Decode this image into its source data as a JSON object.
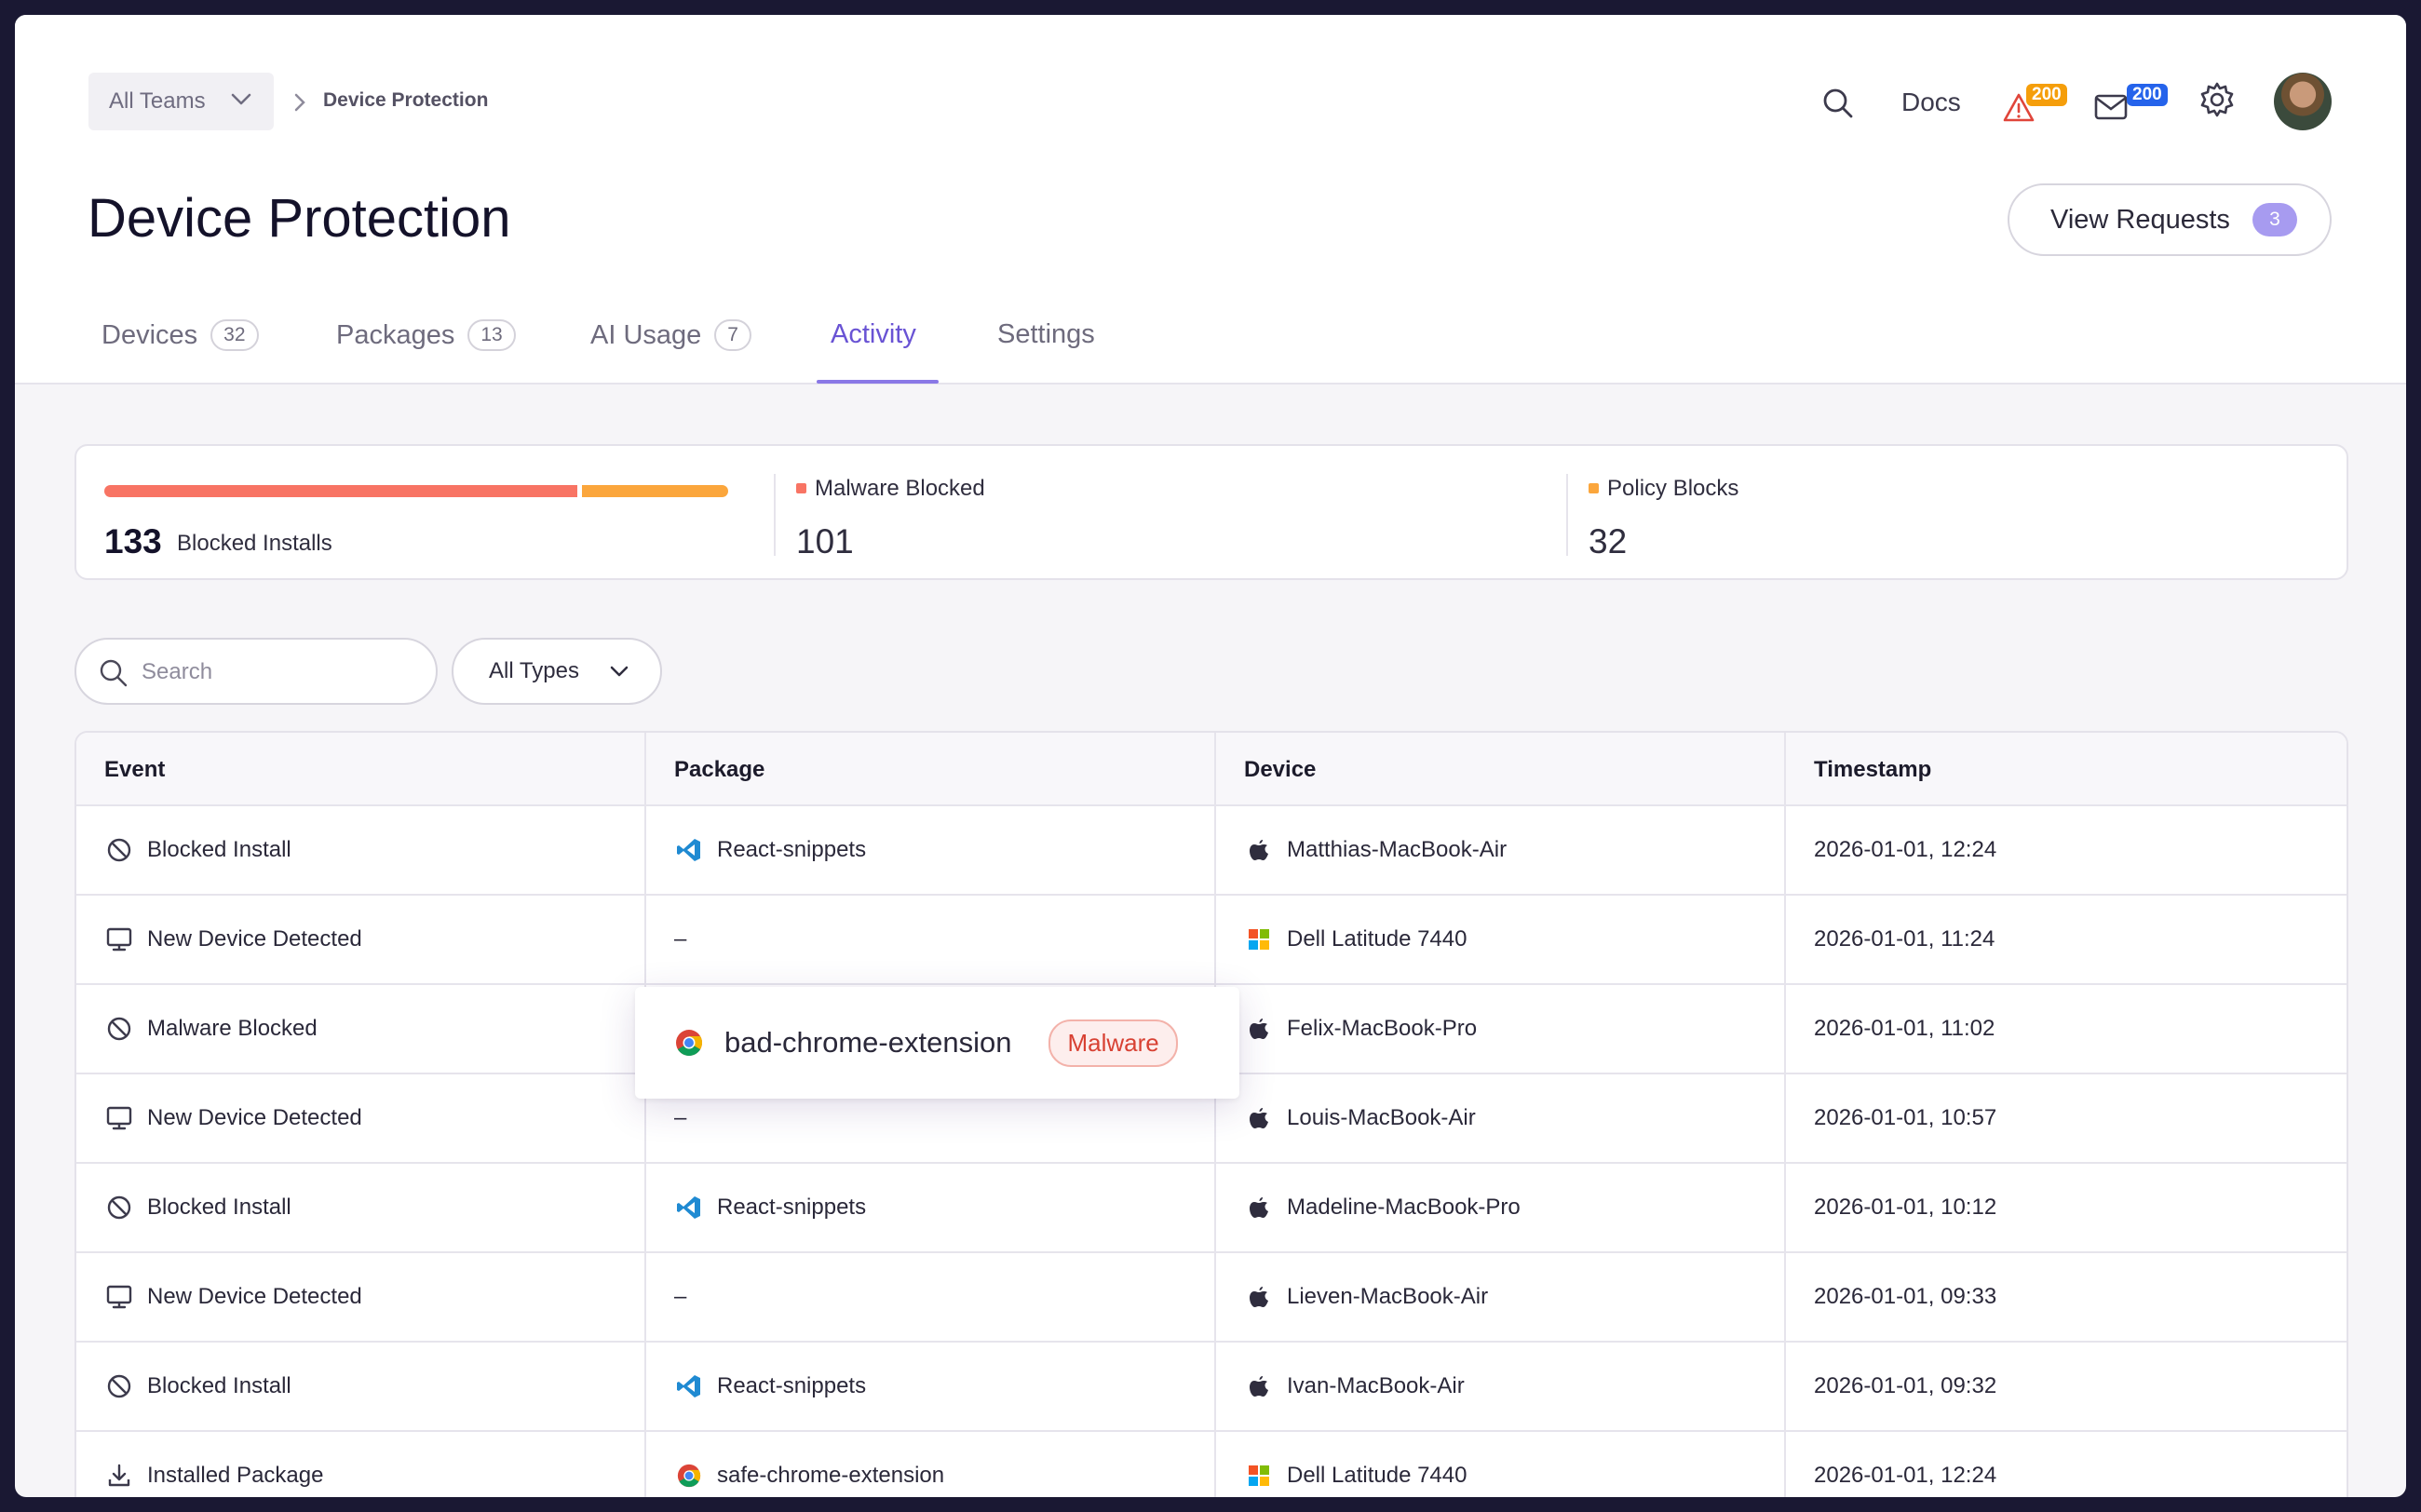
{
  "breadcrumb": {
    "team_select": "All Teams",
    "current": "Device Protection"
  },
  "header": {
    "docs": "Docs",
    "alerts_count": "200",
    "messages_count": "200",
    "alert_color": "#f59e0b",
    "message_color": "#2563eb"
  },
  "page": {
    "title": "Device Protection",
    "view_requests_label": "View Requests",
    "view_requests_count": "3"
  },
  "tabs": [
    {
      "label": "Devices",
      "count": "32"
    },
    {
      "label": "Packages",
      "count": "13"
    },
    {
      "label": "AI Usage",
      "count": "7"
    },
    {
      "label": "Activity",
      "active": true
    },
    {
      "label": "Settings"
    }
  ],
  "summary": {
    "total": "133",
    "total_label": "Blocked Installs",
    "malware_label": "Malware Blocked",
    "malware_value": "101",
    "policy_label": "Policy Blocks",
    "policy_value": "32",
    "malware_color": "#f87464",
    "policy_color": "#fba63c"
  },
  "filters": {
    "search_placeholder": "Search",
    "type_select": "All Types"
  },
  "table": {
    "headers": {
      "event": "Event",
      "package": "Package",
      "device": "Device",
      "timestamp": "Timestamp"
    },
    "rows": [
      {
        "event_icon": "blocked-icon",
        "event": "Blocked Install",
        "package_icon": "vscode-icon",
        "package": "React-snippets",
        "device_icon": "apple-icon",
        "device": "Matthias-MacBook-Air",
        "timestamp": "2026-01-01, 12:24"
      },
      {
        "event_icon": "monitor-icon",
        "event": "New Device Detected",
        "package_icon": "",
        "package": "–",
        "device_icon": "windows-icon",
        "device": "Dell Latitude 7440",
        "timestamp": "2026-01-01, 11:24"
      },
      {
        "event_icon": "blocked-icon",
        "event": "Malware Blocked",
        "package_icon": "",
        "package": "",
        "device_icon": "apple-icon",
        "device": "Felix-MacBook-Pro",
        "timestamp": "2026-01-01, 11:02"
      },
      {
        "event_icon": "monitor-icon",
        "event": "New Device Detected",
        "package_icon": "",
        "package": "–",
        "device_icon": "apple-icon",
        "device": "Louis-MacBook-Air",
        "timestamp": "2026-01-01, 10:57"
      },
      {
        "event_icon": "blocked-icon",
        "event": "Blocked Install",
        "package_icon": "vscode-icon",
        "package": "React-snippets",
        "device_icon": "apple-icon",
        "device": "Madeline-MacBook-Pro",
        "timestamp": "2026-01-01, 10:12"
      },
      {
        "event_icon": "monitor-icon",
        "event": "New Device Detected",
        "package_icon": "",
        "package": "–",
        "device_icon": "apple-icon",
        "device": "Lieven-MacBook-Air",
        "timestamp": "2026-01-01, 09:33"
      },
      {
        "event_icon": "blocked-icon",
        "event": "Blocked Install",
        "package_icon": "vscode-icon",
        "package": "React-snippets",
        "device_icon": "apple-icon",
        "device": "Ivan-MacBook-Air",
        "timestamp": "2026-01-01, 09:32"
      },
      {
        "event_icon": "download-icon",
        "event": "Installed Package",
        "package_icon": "chrome-icon",
        "package": "safe-chrome-extension",
        "device_icon": "windows-icon",
        "device": "Dell Latitude 7440",
        "timestamp": "2026-01-01, 12:24"
      }
    ]
  },
  "popover": {
    "icon": "chrome-icon",
    "package": "bad-chrome-extension",
    "tag": "Malware",
    "tag_color": "#d84133"
  }
}
